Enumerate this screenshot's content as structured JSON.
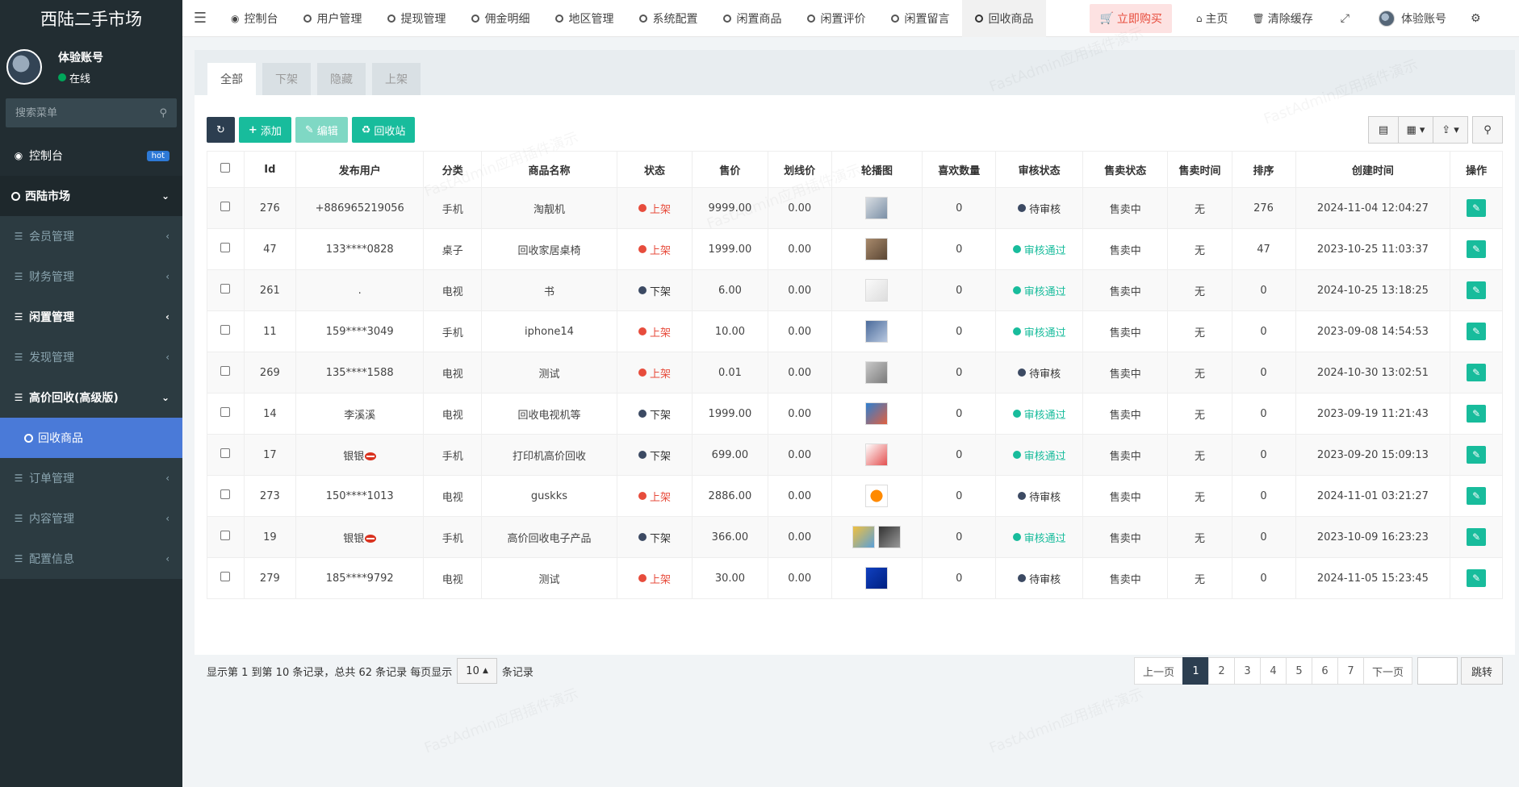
{
  "app": {
    "title": "西陆二手市场"
  },
  "user": {
    "name": "体验账号",
    "status": "在线"
  },
  "sidebar": {
    "search_placeholder": "搜索菜单",
    "items": [
      {
        "label": "控制台",
        "badge": "hot"
      },
      {
        "label": "西陆市场"
      },
      {
        "label": "会员管理"
      },
      {
        "label": "财务管理"
      },
      {
        "label": "闲置管理"
      },
      {
        "label": "发现管理"
      },
      {
        "label": "高价回收(高级版)"
      },
      {
        "label": "回收商品"
      },
      {
        "label": "订单管理"
      },
      {
        "label": "内容管理"
      },
      {
        "label": "配置信息"
      }
    ]
  },
  "topnav": {
    "tabs": [
      "控制台",
      "用户管理",
      "提现管理",
      "佣金明细",
      "地区管理",
      "系统配置",
      "闲置商品",
      "闲置评价",
      "闲置留言",
      "回收商品"
    ],
    "buy_label": "立即购买",
    "home_label": "主页",
    "clear_cache_label": "清除缓存",
    "account_label": "体验账号"
  },
  "panel": {
    "tabs": [
      "全部",
      "下架",
      "隐藏",
      "上架"
    ],
    "toolbar": {
      "add": "添加",
      "edit": "编辑",
      "trash": "回收站"
    }
  },
  "table": {
    "headers": [
      "Id",
      "发布用户",
      "分类",
      "商品名称",
      "状态",
      "售价",
      "划线价",
      "轮播图",
      "喜欢数量",
      "审核状态",
      "售卖状态",
      "售卖时间",
      "排序",
      "创建时间",
      "操作"
    ],
    "rows": [
      {
        "id": "276",
        "user": "+886965219056",
        "cat": "手机",
        "name": "淘靓机",
        "status": "上架",
        "price": "9999.00",
        "orig": "0.00",
        "likes": "0",
        "review": "待审核",
        "sale": "售卖中",
        "time": "无",
        "sort": "276",
        "created": "2024-11-04 12:04:27"
      },
      {
        "id": "47",
        "user": "133****0828",
        "cat": "桌子",
        "name": "回收家居桌椅",
        "status": "上架",
        "price": "1999.00",
        "orig": "0.00",
        "likes": "0",
        "review": "审核通过",
        "sale": "售卖中",
        "time": "无",
        "sort": "47",
        "created": "2023-10-25 11:03:37"
      },
      {
        "id": "261",
        "user": ".",
        "cat": "电视",
        "name": "书",
        "status": "下架",
        "price": "6.00",
        "orig": "0.00",
        "likes": "0",
        "review": "审核通过",
        "sale": "售卖中",
        "time": "无",
        "sort": "0",
        "created": "2024-10-25 13:18:25"
      },
      {
        "id": "11",
        "user": "159****3049",
        "cat": "手机",
        "name": "iphone14",
        "status": "上架",
        "price": "10.00",
        "orig": "0.00",
        "likes": "0",
        "review": "审核通过",
        "sale": "售卖中",
        "time": "无",
        "sort": "0",
        "created": "2023-09-08 14:54:53"
      },
      {
        "id": "269",
        "user": "135****1588",
        "cat": "电视",
        "name": "测试",
        "status": "上架",
        "price": "0.01",
        "orig": "0.00",
        "likes": "0",
        "review": "待审核",
        "sale": "售卖中",
        "time": "无",
        "sort": "0",
        "created": "2024-10-30 13:02:51"
      },
      {
        "id": "14",
        "user": "李溪溪",
        "cat": "电视",
        "name": "回收电视机等",
        "status": "下架",
        "price": "1999.00",
        "orig": "0.00",
        "likes": "0",
        "review": "审核通过",
        "sale": "售卖中",
        "time": "无",
        "sort": "0",
        "created": "2023-09-19 11:21:43"
      },
      {
        "id": "17",
        "user": "银银",
        "cat": "手机",
        "name": "打印机高价回收",
        "status": "下架",
        "price": "699.00",
        "orig": "0.00",
        "likes": "0",
        "review": "审核通过",
        "sale": "售卖中",
        "time": "无",
        "sort": "0",
        "created": "2023-09-20 15:09:13"
      },
      {
        "id": "273",
        "user": "150****1013",
        "cat": "电视",
        "name": "guskks",
        "status": "上架",
        "price": "2886.00",
        "orig": "0.00",
        "likes": "0",
        "review": "待审核",
        "sale": "售卖中",
        "time": "无",
        "sort": "0",
        "created": "2024-11-01 03:21:27"
      },
      {
        "id": "19",
        "user": "银银",
        "cat": "手机",
        "name": "高价回收电子产品",
        "status": "下架",
        "price": "366.00",
        "orig": "0.00",
        "likes": "0",
        "review": "审核通过",
        "sale": "售卖中",
        "time": "无",
        "sort": "0",
        "created": "2023-10-09 16:23:23"
      },
      {
        "id": "279",
        "user": "185****9792",
        "cat": "电视",
        "name": "测试",
        "status": "上架",
        "price": "30.00",
        "orig": "0.00",
        "likes": "0",
        "review": "待审核",
        "sale": "售卖中",
        "time": "无",
        "sort": "0",
        "created": "2024-11-05 15:23:45"
      }
    ]
  },
  "pager": {
    "info_prefix": "显示第 1 到第 10 条记录，总共 62 条记录 每页显示",
    "page_size": "10",
    "info_suffix": "条记录",
    "prev": "上一页",
    "next": "下一页",
    "pages": [
      "1",
      "2",
      "3",
      "4",
      "5",
      "6",
      "7"
    ],
    "jump": "跳转"
  },
  "watermark": "FastAdmin应用插件演示",
  "colors": {
    "sidebar_bg": "#222d32",
    "accent_green": "#18bc9c",
    "status_red": "#e74c3c",
    "active_blue": "#4a7ad8",
    "dark": "#2c3e50"
  }
}
